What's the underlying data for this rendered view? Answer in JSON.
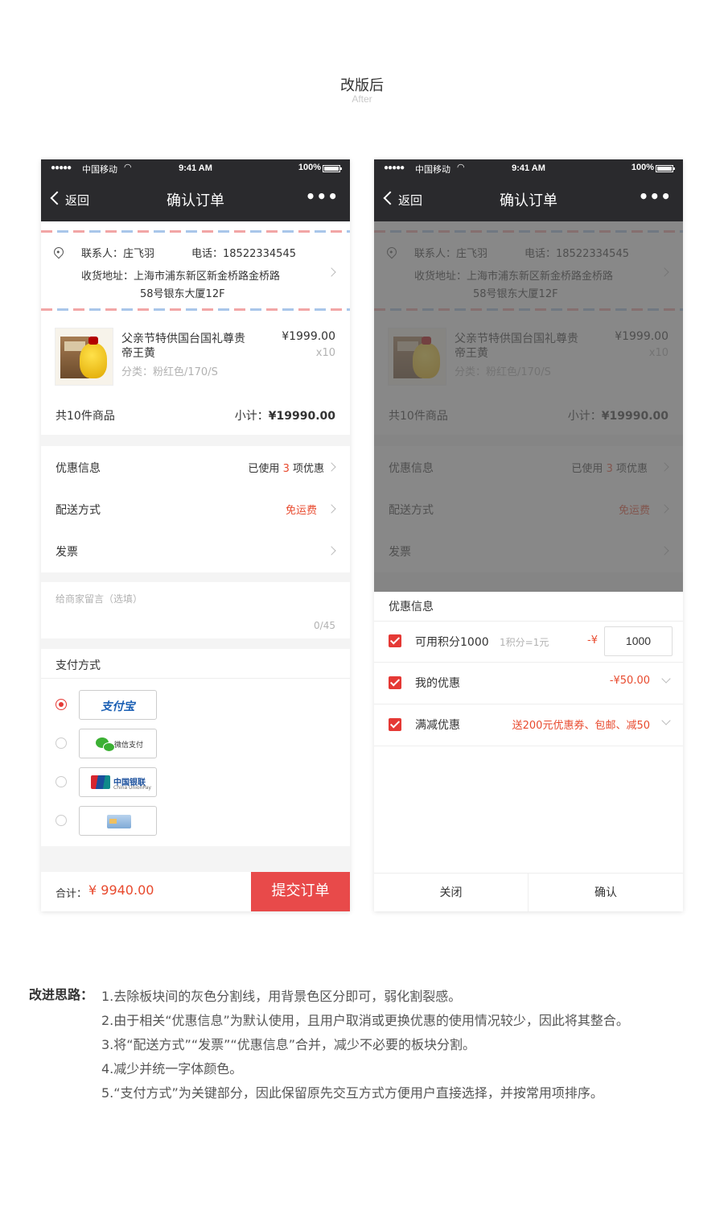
{
  "header": {
    "title": "改版后",
    "subtitle": "After"
  },
  "status_bar": {
    "carrier": "中国移动",
    "signal": "●●●●●",
    "wifi": "wifi-icon",
    "time": "9:41 AM",
    "battery": "100%"
  },
  "nav": {
    "back_label": "返回",
    "title": "确认订单",
    "more": "•••"
  },
  "address": {
    "contact": "联系人：庄飞羽",
    "phone": "电话：18522334545",
    "line1": "收货地址：上海市浦东新区新金桥路金桥路",
    "line2": "58号银东大厦12F"
  },
  "product": {
    "name_line1": "父亲节特供国台国礼尊贵",
    "name_line2": "帝王黄",
    "price": "¥1999.00",
    "qty": "x10",
    "spec": "分类：粉红色/170/S",
    "count_label": "共10件商品",
    "subtotal_label": "小计：",
    "subtotal_value": "¥19990.00"
  },
  "options": {
    "discount_label": "优惠信息",
    "discount_value_prefix": "已使用",
    "discount_count": "3",
    "discount_value_suffix": "项优惠",
    "delivery_label": "配送方式",
    "delivery_value": "免运费",
    "invoice_label": "发票"
  },
  "message": {
    "placeholder": "给商家留言（选填）",
    "counter": "0/45"
  },
  "payment": {
    "title": "支付方式",
    "alipay": "支付宝",
    "wechat": "微信支付",
    "unionpay": "中国银联",
    "unionpay_sub": "China UnionPay",
    "selected": "alipay"
  },
  "footer": {
    "total_label": "合计：",
    "total_value": "¥ 9940.00",
    "submit": "提交订单"
  },
  "sheet": {
    "title": "优惠信息",
    "points_label": "可用积分1000",
    "points_rule": "1积分=1元",
    "points_minus": "-¥",
    "points_value": "1000",
    "coupon_label": "我的优惠",
    "coupon_value": "-¥50.00",
    "promo_label": "满减优惠",
    "promo_value": "送200元优惠券、包邮、减50",
    "close": "关闭",
    "confirm": "确认"
  },
  "notes": {
    "title": "改进思路：",
    "items": [
      "1.去除板块间的灰色分割线，用背景色区分即可，弱化割裂感。",
      "2.由于相关“优惠信息”为默认使用，且用户取消或更换优惠的使用情况较少，因此将其整合。",
      "3.将“配送方式”“发票”“优惠信息”合并，减少不必要的板块分割。",
      "4.减少并统一字体颜色。",
      "5.“支付方式”为关键部分，因此保留原先交互方式方便用户直接选择，并按常用项排序。"
    ]
  },
  "colors": {
    "accent": "#e84a4a",
    "nav_bg": "#2a2a2d",
    "highlight": "#e84a2e"
  }
}
